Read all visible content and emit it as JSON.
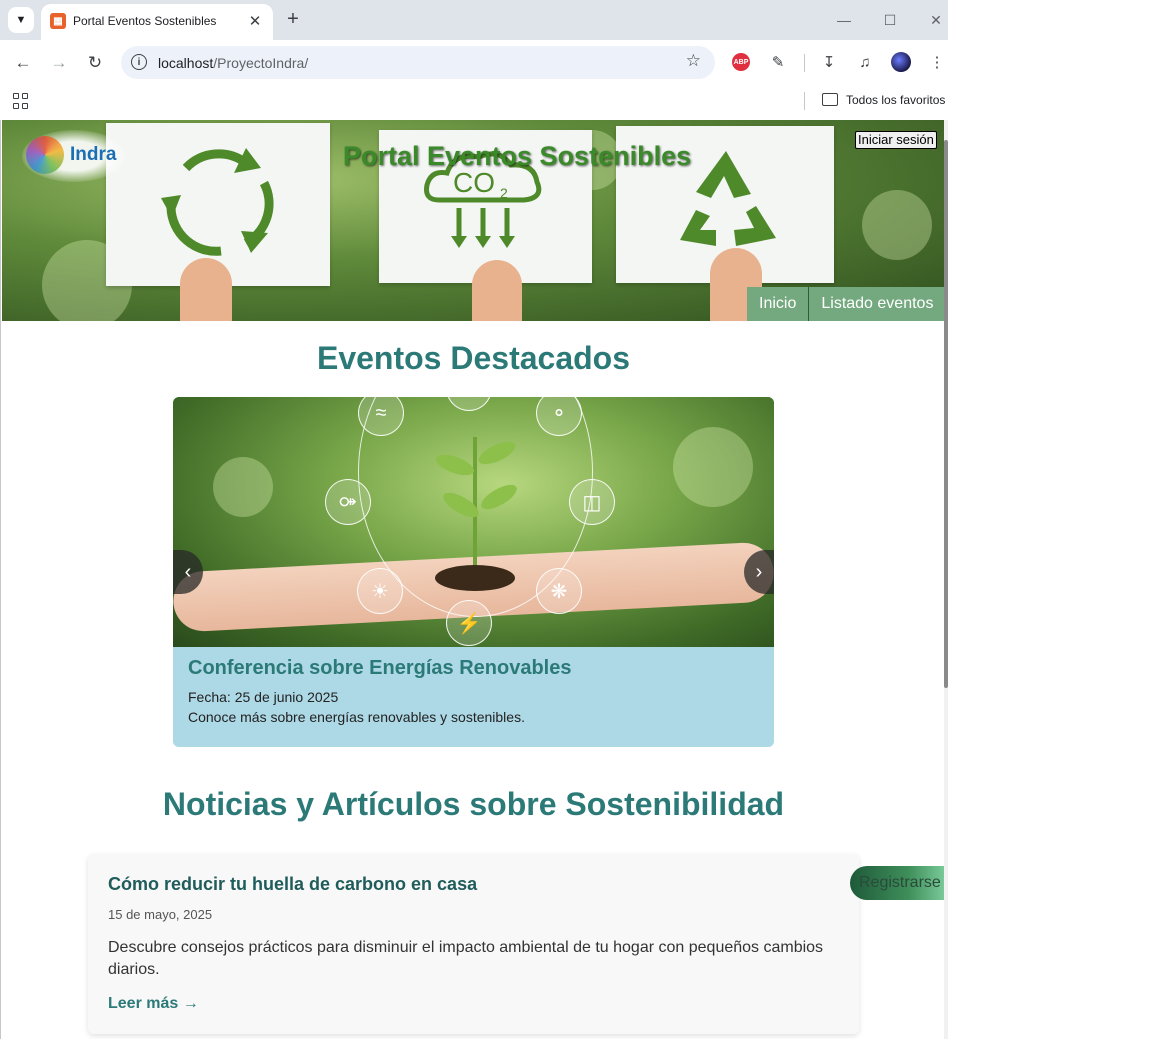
{
  "browser": {
    "tab_title": "Portal Eventos Sostenibles",
    "url_host": "localhost",
    "url_path": "/ProyectoIndra/",
    "bookmarks_folder_label": "Todos los favoritos",
    "abp_label": "ABP"
  },
  "header": {
    "logo_text": "Indra",
    "site_title": "Portal Eventos Sostenibles",
    "login_label": "Iniciar sesión",
    "nav": [
      "Inicio",
      "Listado eventos"
    ],
    "banner_cards": [
      "recycle-arrows-icon",
      "co2-icon",
      "recycle-symbol-icon"
    ]
  },
  "featured": {
    "heading": "Eventos Destacados",
    "prev_label": "‹",
    "next_label": "›",
    "slide": {
      "title": "Conferencia sobre Energías Renovables",
      "date": "Fecha: 25 de junio 2025",
      "description": "Conoce más sobre energías renovables y sostenibles."
    }
  },
  "news": {
    "heading": "Noticias y Artículos sobre Sostenibilidad",
    "articles": [
      {
        "title": "Cómo reducir tu huella de carbono en casa",
        "date": "15 de mayo, 2025",
        "body": "Descubre consejos prácticos para disminuir el impacto ambiental de tu hogar con pequeños cambios diarios.",
        "link": "Leer más →"
      }
    ]
  },
  "register_label": "Registrarse",
  "colors": {
    "accent_teal": "#2b7a78",
    "nav_green": "#74a97f",
    "caption_blue": "#add8e6"
  }
}
